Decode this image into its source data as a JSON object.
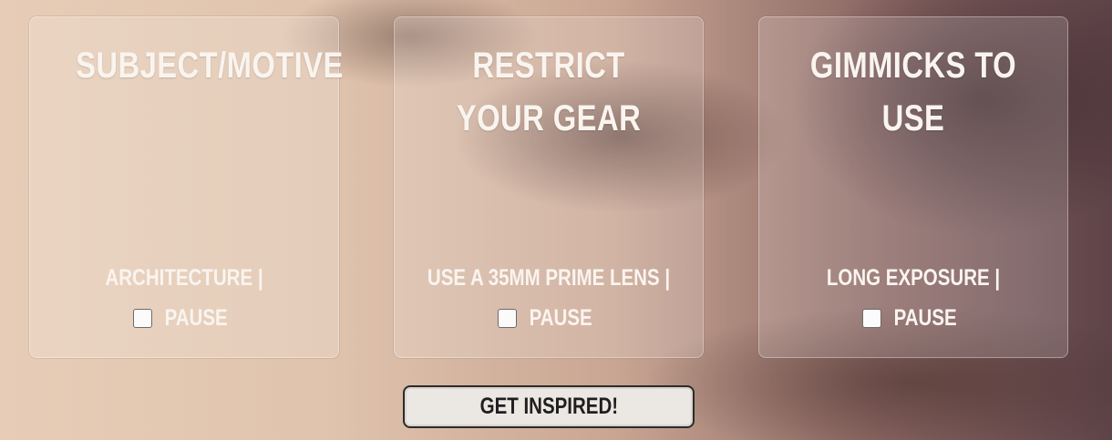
{
  "cards": [
    {
      "title": "SUBJECT/MOTIVE",
      "value": "ARCHITECTURE |",
      "pause_label": "PAUSE",
      "pause_checked": false
    },
    {
      "title": "RESTRICT YOUR GEAR",
      "value": "USE A 35MM PRIME LENS |",
      "pause_label": "PAUSE",
      "pause_checked": false
    },
    {
      "title": "GIMMICKS TO USE",
      "value": "LONG EXPOSURE |",
      "pause_label": "PAUSE",
      "pause_checked": false
    }
  ],
  "inspire_button": {
    "label": "GET INSPIRED!"
  }
}
